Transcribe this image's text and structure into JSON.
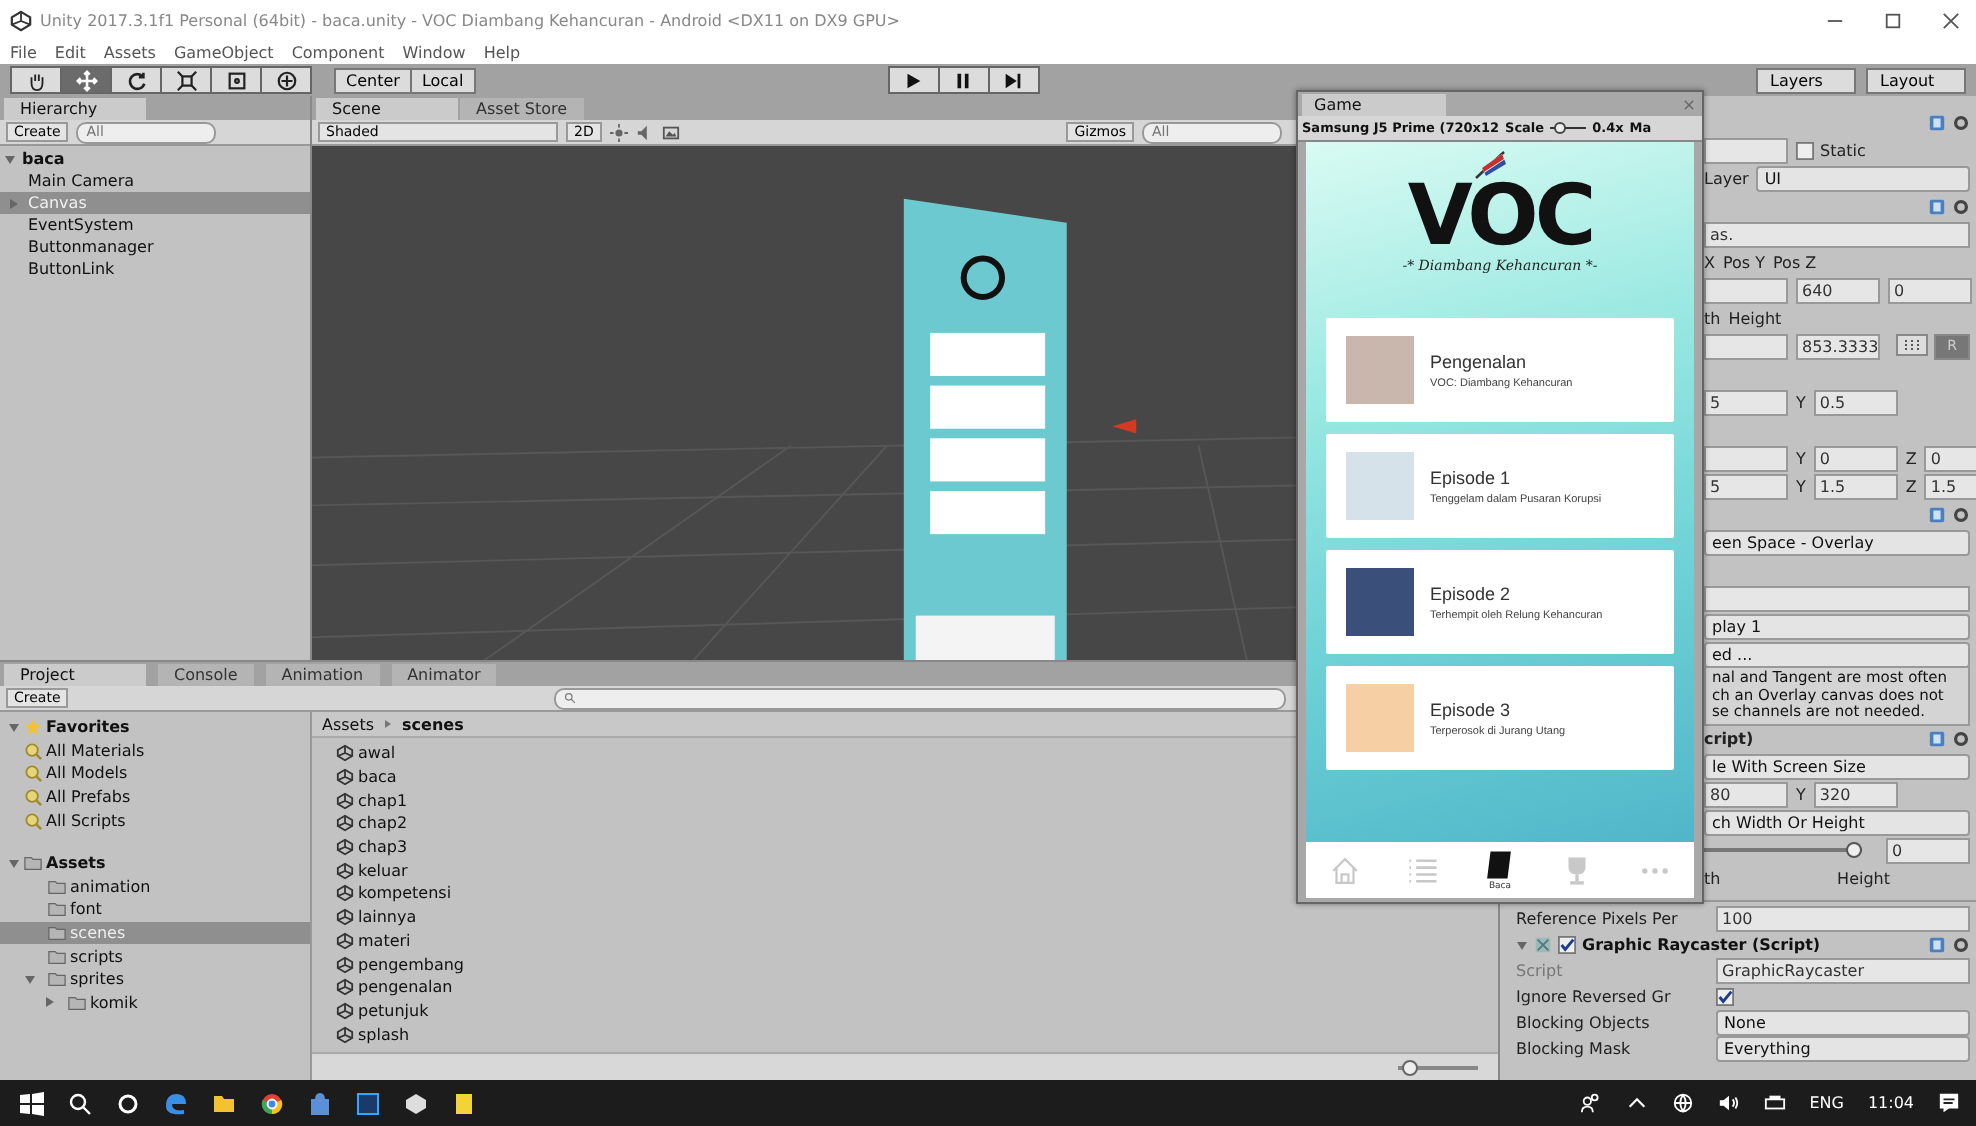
{
  "window": {
    "title": "Unity 2017.3.1f1 Personal (64bit) - baca.unity - VOC Diambang Kehancuran - Android <DX11 on DX9 GPU>"
  },
  "menu": [
    "File",
    "Edit",
    "Assets",
    "GameObject",
    "Component",
    "Window",
    "Help"
  ],
  "toolbar": {
    "tools": [
      {
        "kind": "hand",
        "selected": false
      },
      {
        "kind": "move",
        "selected": true
      },
      {
        "kind": "rotate",
        "selected": false
      },
      {
        "kind": "scale",
        "selected": false
      },
      {
        "kind": "rect",
        "selected": false
      },
      {
        "kind": "transform",
        "selected": false
      }
    ],
    "pivot": [
      "Center",
      "Local"
    ],
    "layers": "Layers",
    "layout": "Layout"
  },
  "hierarchy": {
    "tab": "Hierarchy",
    "create": "Create",
    "search_placeholder": "All",
    "scene": "baca",
    "expanded": true,
    "items": [
      {
        "label": "Main Camera",
        "selected": false
      },
      {
        "label": "Canvas",
        "selected": true,
        "expanded": false
      },
      {
        "label": "EventSystem",
        "selected": false
      },
      {
        "label": "Buttonmanager",
        "selected": false
      },
      {
        "label": "ButtonLink",
        "selected": false
      }
    ]
  },
  "scene_view": {
    "tabs": [
      {
        "label": "Scene",
        "selected": true
      },
      {
        "label": "Asset Store",
        "selected": false
      }
    ],
    "shading": "Shaded",
    "mode_2d": "2D",
    "gizmos": "Gizmos",
    "search_placeholder": "All"
  },
  "game_view": {
    "tab": "Game",
    "device": "Samsung J5 Prime (720x12",
    "scale_label": "Scale",
    "scale_slider": {
      "level": 0.12
    },
    "scale_value": "0.4x",
    "maximize": "Ma",
    "app": {
      "logo": "VOC",
      "tagline": "-* Diambang Kehancuran *-",
      "cards": [
        {
          "title": "Pengenalan",
          "subtitle": "VOC: Diambang Kehancuran"
        },
        {
          "title": "Episode 1",
          "subtitle": "Tenggelam dalam Pusaran Korupsi"
        },
        {
          "title": "Episode 2",
          "subtitle": "Terhempit oleh Relung Kehancuran"
        },
        {
          "title": "Episode 3",
          "subtitle": "Terperosok di Jurang Utang"
        }
      ],
      "nav": [
        {
          "kind": "home",
          "selected": false
        },
        {
          "kind": "list",
          "selected": false
        },
        {
          "kind": "book",
          "selected": true,
          "label": "Baca"
        },
        {
          "kind": "trophy",
          "selected": false
        },
        {
          "kind": "dots",
          "selected": false
        }
      ]
    }
  },
  "inspector": {
    "upper_rows": [
      [
        {
          "kind": "icons"
        }
      ],
      [
        {
          "kind": "field"
        },
        {
          "kind": "check",
          "text": "Static",
          "checked": false
        }
      ],
      [
        {
          "kind": "label",
          "text": "Layer"
        },
        {
          "kind": "dropdown",
          "text": "UI"
        }
      ],
      [
        {
          "kind": "icons"
        }
      ],
      [
        {
          "kind": "longfield",
          "text": "as."
        }
      ],
      [
        {
          "kind": "label",
          "text": "X"
        },
        {
          "kind": "label",
          "text": "Pos Y"
        },
        {
          "kind": "label",
          "text": "Pos Z"
        }
      ],
      [
        {
          "kind": "field"
        },
        {
          "kind": "field",
          "text": "640"
        },
        {
          "kind": "field",
          "text": "0"
        }
      ],
      [
        {
          "kind": "label",
          "text": "th"
        },
        {
          "kind": "label",
          "text": "Height"
        }
      ],
      [
        {
          "kind": "field"
        },
        {
          "kind": "field",
          "text": "853.3333"
        },
        {
          "kind": "button",
          "text": "R"
        }
      ],
      [],
      [
        {
          "kind": "field",
          "text": "5"
        },
        {
          "kind": "label",
          "text": "Y"
        },
        {
          "kind": "field",
          "text": "0.5"
        }
      ],
      [],
      [
        {
          "kind": "field"
        },
        {
          "kind": "label",
          "text": "Y"
        },
        {
          "kind": "field",
          "text": "0"
        },
        {
          "kind": "label",
          "text": "Z"
        },
        {
          "kind": "field",
          "text": "0"
        }
      ],
      [
        {
          "kind": "field",
          "text": "5"
        },
        {
          "kind": "label",
          "text": "Y"
        },
        {
          "kind": "field",
          "text": "1.5"
        },
        {
          "kind": "label",
          "text": "Z"
        },
        {
          "kind": "field",
          "text": "1.5"
        }
      ],
      [
        {
          "kind": "icons"
        }
      ],
      [
        {
          "kind": "dropdown",
          "text": "een Space - Overlay"
        }
      ],
      [],
      [
        {
          "kind": "longfield"
        }
      ],
      [
        {
          "kind": "dropdown",
          "text": "play 1"
        }
      ],
      [
        {
          "kind": "dropdown",
          "text": "ed ..."
        }
      ],
      [
        {
          "kind": "help",
          "lines": [
            "nal and Tangent are most often",
            "ch an Overlay canvas does not",
            "se channels are not needed."
          ]
        }
      ],
      [
        {
          "kind": "bold",
          "text": "cript)"
        },
        {
          "kind": "icons"
        }
      ],
      [
        {
          "kind": "dropdown",
          "text": "le With Screen Size"
        }
      ],
      [
        {
          "kind": "field",
          "text": "80"
        },
        {
          "kind": "label",
          "text": "Y"
        },
        {
          "kind": "field",
          "text": "320"
        }
      ],
      [
        {
          "kind": "dropdown",
          "text": "ch Width Or Height"
        }
      ],
      [
        {
          "kind": "slider",
          "level": 1
        },
        {
          "kind": "field",
          "text": "0"
        }
      ],
      [
        {
          "kind": "label",
          "text": "th"
        },
        {
          "kind": "rightlabel",
          "text": "Height"
        }
      ]
    ],
    "lower_rows": [
      [
        {
          "kind": "label",
          "text": "Reference Pixels Per"
        },
        {
          "kind": "longfield",
          "text": "100"
        }
      ],
      [
        {
          "kind": "component",
          "text": "Graphic Raycaster (Script)",
          "checked": true
        },
        {
          "kind": "icons"
        }
      ],
      [
        {
          "kind": "dim",
          "text": "Script"
        },
        {
          "kind": "longfield",
          "text": "GraphicRaycaster"
        }
      ],
      [
        {
          "kind": "label",
          "text": "Ignore Reversed Gr"
        },
        {
          "kind": "check",
          "checked": true
        }
      ],
      [
        {
          "kind": "label",
          "text": "Blocking Objects"
        },
        {
          "kind": "dropdown",
          "text": "None"
        }
      ],
      [
        {
          "kind": "label",
          "text": "Blocking Mask"
        },
        {
          "kind": "dropdown",
          "text": "Everything"
        }
      ]
    ]
  },
  "project": {
    "tabs": [
      {
        "label": "Project",
        "selected": true
      },
      {
        "label": "Console",
        "selected": false
      },
      {
        "label": "Animation",
        "selected": false
      },
      {
        "label": "Animator",
        "selected": false
      }
    ],
    "create": "Create",
    "favorites": {
      "label": "Favorites",
      "expanded": true,
      "items": [
        "All Materials",
        "All Models",
        "All Prefabs",
        "All Scripts"
      ]
    },
    "assets": {
      "label": "Assets",
      "expanded": true,
      "selected": false,
      "children": [
        {
          "label": "animation",
          "selected": false
        },
        {
          "label": "font",
          "selected": false
        },
        {
          "label": "scenes",
          "selected": true
        },
        {
          "label": "scripts",
          "selected": false
        },
        {
          "label": "sprites",
          "selected": false,
          "expanded": true,
          "children": [
            {
              "label": "komik",
              "selected": false,
              "expanded": false
            }
          ]
        }
      ]
    },
    "breadcrumb": [
      "Assets",
      "scenes"
    ],
    "files": [
      "awal",
      "baca",
      "chap1",
      "chap2",
      "chap3",
      "keluar",
      "kompetensi",
      "lainnya",
      "materi",
      "pengembang",
      "pengenalan",
      "petunjuk",
      "splash"
    ],
    "icon_size_slider": {
      "level": 0.05
    }
  },
  "taskbar": {
    "apps": [
      {
        "kind": "search"
      },
      {
        "kind": "cortana"
      },
      {
        "kind": "edge"
      },
      {
        "kind": "explorer"
      },
      {
        "kind": "chrome"
      },
      {
        "kind": "store"
      },
      {
        "kind": "photoshop"
      },
      {
        "kind": "unity"
      },
      {
        "kind": "notes"
      }
    ],
    "language": "ENG",
    "time": "11:04"
  }
}
